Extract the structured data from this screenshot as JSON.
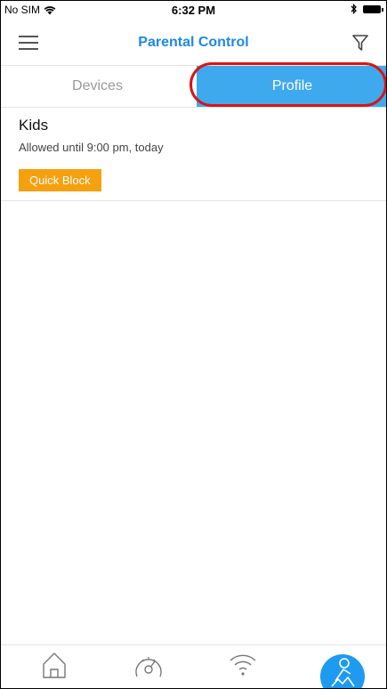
{
  "status_bar": {
    "carrier": "No SIM",
    "time": "6:32 PM"
  },
  "nav": {
    "title": "Parental Control"
  },
  "tabs": [
    {
      "label": "Devices",
      "selected": false
    },
    {
      "label": "Profile",
      "selected": true
    }
  ],
  "profiles": [
    {
      "name": "Kids",
      "status": "Allowed until 9:00 pm, today",
      "action_label": "Quick Block"
    }
  ],
  "tab_bar": {
    "items": [
      {
        "icon": "home-icon",
        "active": false
      },
      {
        "icon": "speedometer-icon",
        "active": false
      },
      {
        "icon": "wifi-icon",
        "active": false
      },
      {
        "icon": "parental-control-icon",
        "active": true
      }
    ]
  },
  "colors": {
    "accent": "#1e88e5",
    "tab_selected": "#3fa9ee",
    "quick_block": "#f5a00f",
    "highlight": "#d91414"
  }
}
